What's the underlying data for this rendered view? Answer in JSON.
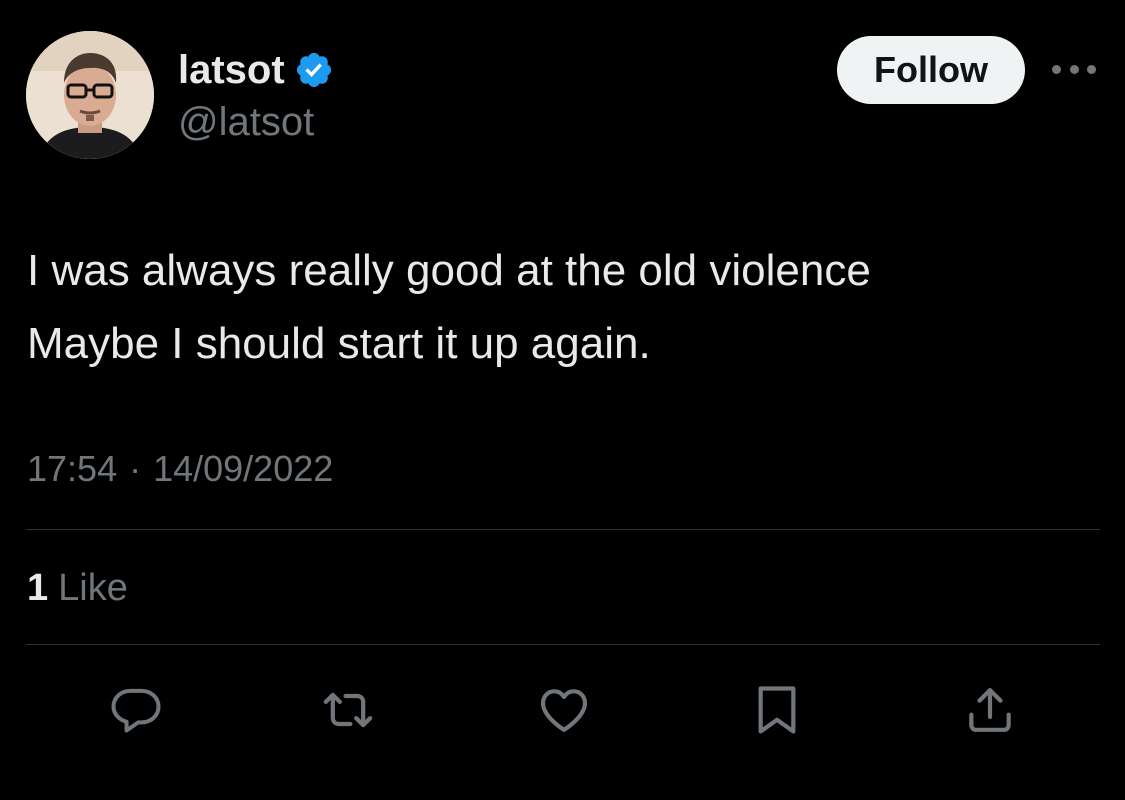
{
  "author": {
    "display_name": "latsot",
    "handle": "@latsot",
    "verified": true,
    "avatar_icon": "profile-photo"
  },
  "header": {
    "follow_label": "Follow",
    "more_icon": "more-horizontal-icon"
  },
  "tweet": {
    "lines": [
      "I was always really good at the old violence",
      "Maybe I should start it up again."
    ],
    "time": "17:54",
    "separator": "·",
    "date": "14/09/2022"
  },
  "stats": {
    "likes_count": "1",
    "likes_label": "Like"
  },
  "actions": [
    {
      "name": "reply",
      "icon": "reply-icon"
    },
    {
      "name": "retweet",
      "icon": "retweet-icon"
    },
    {
      "name": "like",
      "icon": "heart-icon"
    },
    {
      "name": "bookmark",
      "icon": "bookmark-icon"
    },
    {
      "name": "share",
      "icon": "share-icon"
    }
  ],
  "colors": {
    "background": "#000000",
    "primary_text": "#e7e9ea",
    "secondary_text": "#71767b",
    "divider": "#2f3336",
    "verified_blue": "#1d9bf0",
    "follow_button_bg": "#eff3f4"
  }
}
